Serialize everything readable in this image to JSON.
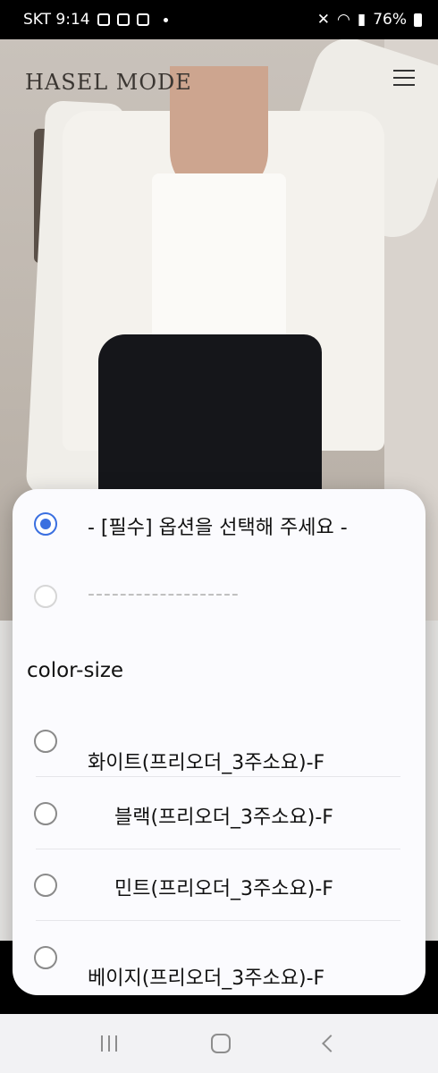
{
  "status_bar": {
    "carrier_time": "SKT 9:14",
    "battery": "76%"
  },
  "site": {
    "logo": "HASEL MODE"
  },
  "option_sheet": {
    "placeholder_option": "- [필수] 옵션을 선택해 주세요 -",
    "separator_option": "-------------------",
    "group_label": "color-size",
    "options": [
      "화이트(프리오더_3주소요)-F",
      "블랙(프리오더_3주소요)-F",
      "민트(프리오더_3주소요)-F",
      "베이지(프리오더_3주소요)-F"
    ],
    "accent_color": "#3a6fe0"
  },
  "icons": {
    "menu": "hamburger-icon",
    "nav_recent": "recent-apps-icon",
    "nav_home": "home-icon",
    "nav_back": "back-icon"
  }
}
